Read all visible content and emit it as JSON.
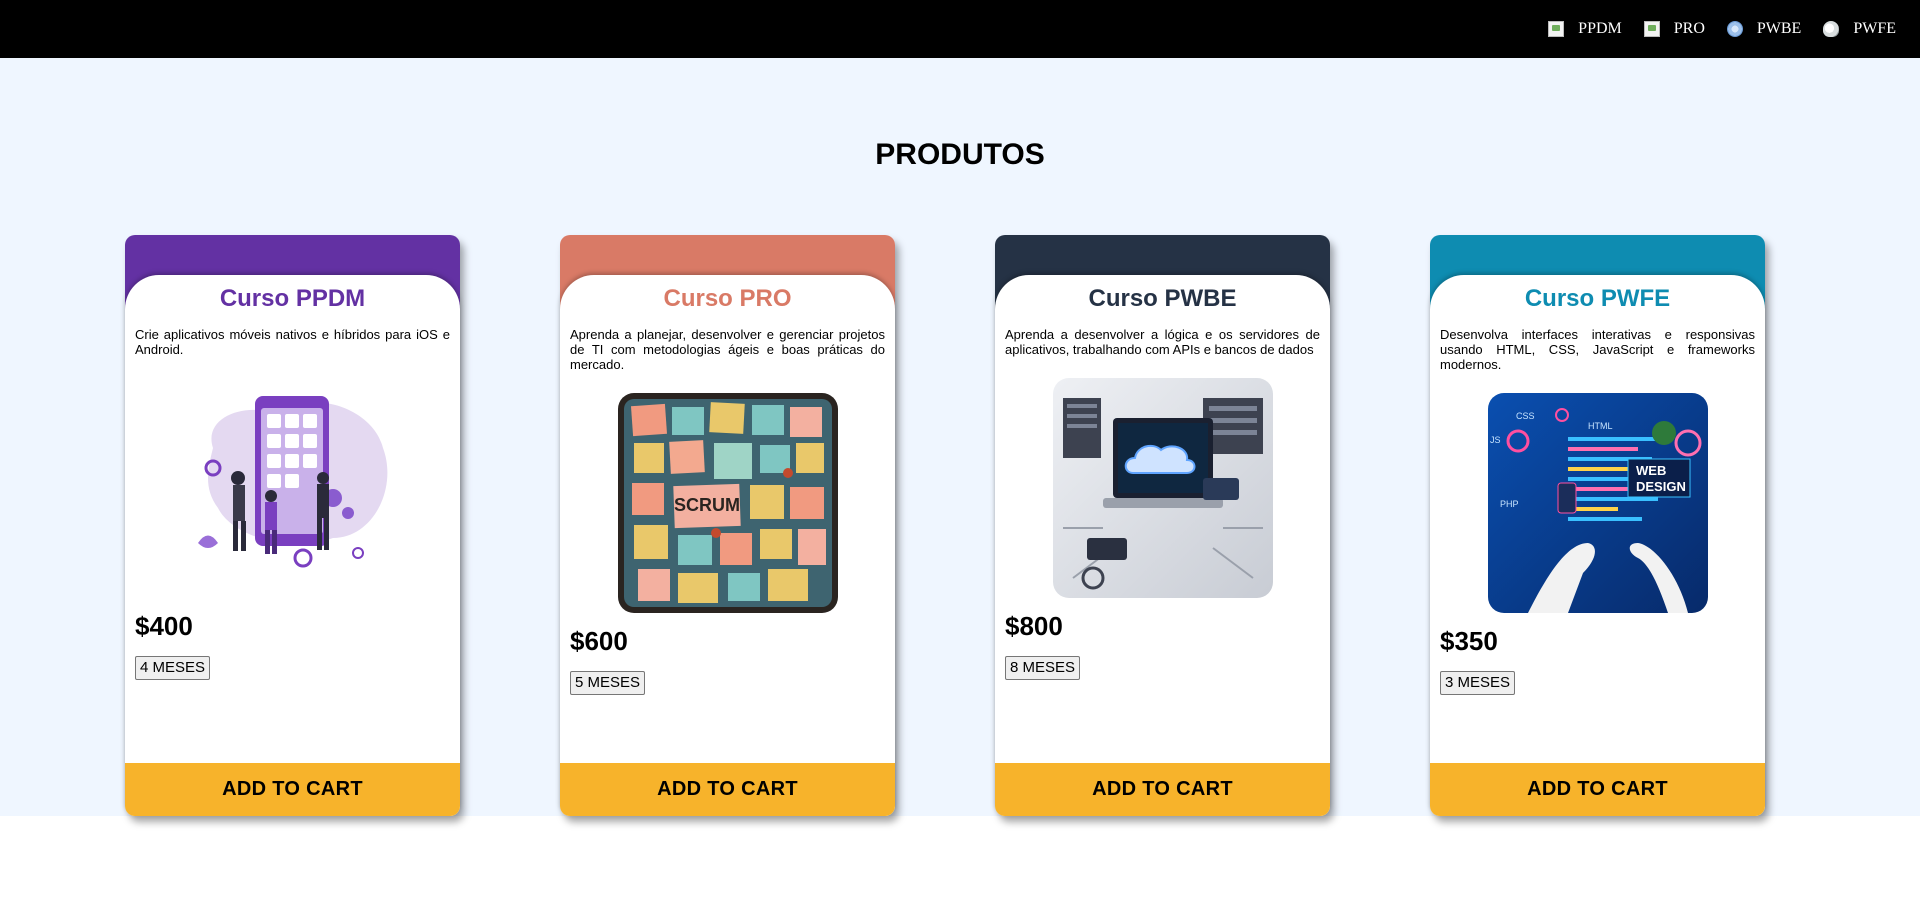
{
  "nav": {
    "items": [
      {
        "label": "PPDM",
        "icon": "broken-image-icon"
      },
      {
        "label": "PRO",
        "icon": "broken-image-icon"
      },
      {
        "label": "PWBE",
        "icon": "globe-icon"
      },
      {
        "label": "PWFE",
        "icon": "cloud-icon"
      }
    ]
  },
  "section": {
    "title": "PRODUTOS"
  },
  "cards": [
    {
      "title": "Curso PPDM",
      "description": "Crie aplicativos móveis nativos e híbridos para iOS e Android.",
      "price": "$400",
      "duration": "4 MESES",
      "cart_label": "ADD TO CART",
      "accent_color": "#6331a3",
      "image": "mobile-app-development-illustration"
    },
    {
      "title": "Curso PRO",
      "description": "Aprenda a planejar, desenvolver e gerenciar projetos de TI com metodologias ágeis e boas práticas do mercado.",
      "price": "$600",
      "duration": "5 MESES",
      "cart_label": "ADD TO CART",
      "accent_color": "#d97a66",
      "image": "scrum-board-illustration",
      "image_text": "SCRUM"
    },
    {
      "title": "Curso PWBE",
      "description": "Aprenda a desenvolver a lógica e os servidores de aplicativos, trabalhando com APIs e bancos de dados",
      "price": "$800",
      "duration": "8 MESES",
      "cart_label": "ADD TO CART",
      "accent_color": "#253245",
      "image": "cloud-server-laptop-illustration"
    },
    {
      "title": "Curso PWFE",
      "description": "Desenvolva interfaces interativas e responsivas usando HTML, CSS, JavaScript e frameworks modernos.",
      "price": "$350",
      "duration": "3 MESES",
      "cart_label": "ADD TO CART",
      "accent_color": "#0e8cb1",
      "image": "web-design-illustration",
      "image_text": [
        "CSS",
        "HTML",
        "JS",
        "PHP",
        "WEB",
        "DESIGN"
      ]
    }
  ]
}
